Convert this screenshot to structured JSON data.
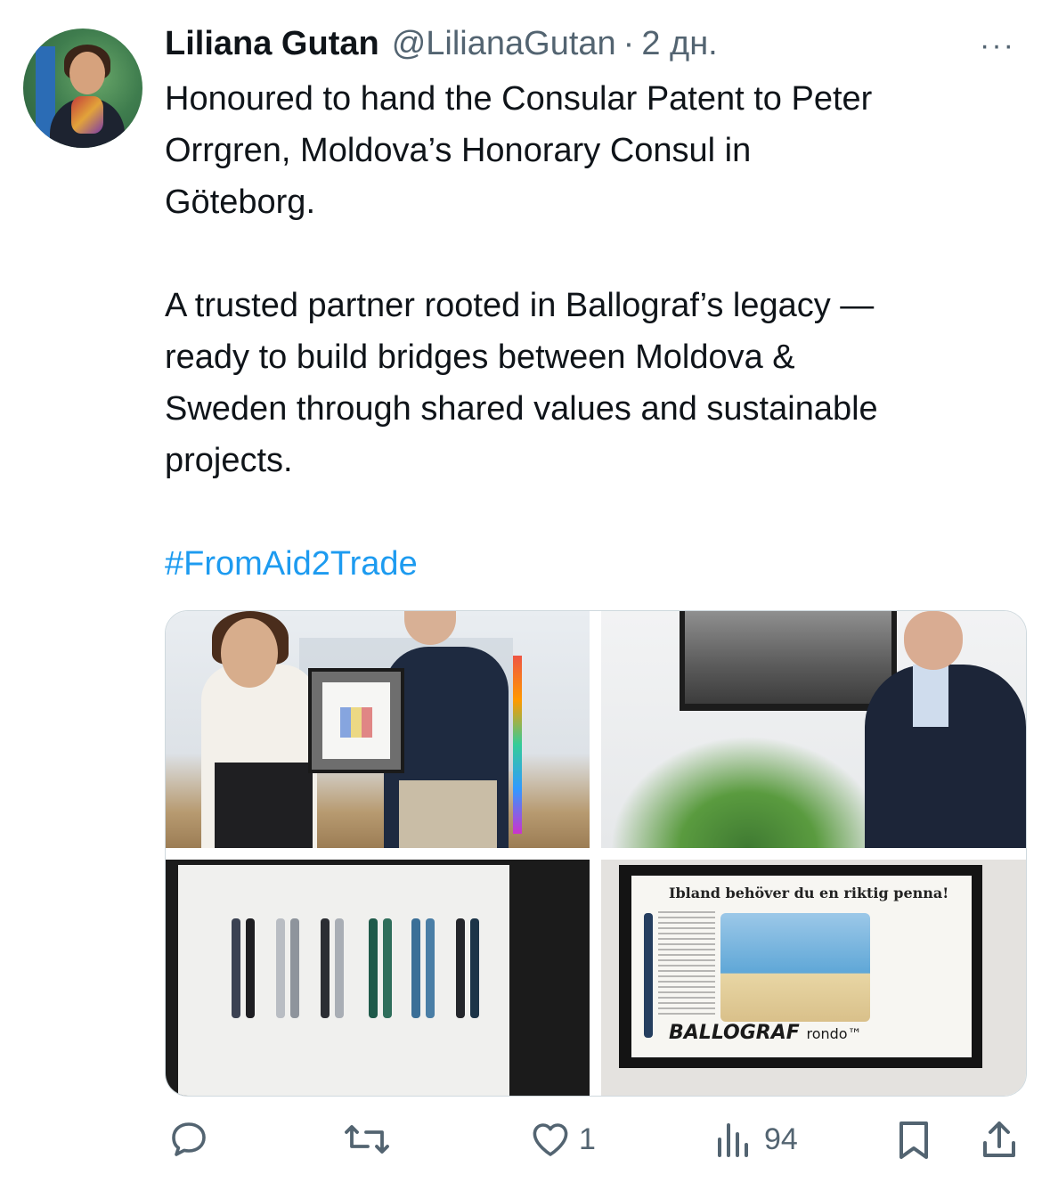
{
  "tweet": {
    "author_name": "Liliana Gutan",
    "handle": "@LilianaGutan",
    "separator": "·",
    "time": "2 дн.",
    "more_label": "···",
    "text_lines_p1": [
      "Honoured to hand the Consular Patent to Peter",
      "Orrgren, Moldova’s Honorary Consul in",
      "Göteborg."
    ],
    "text_lines_p2": [
      "A trusted partner rooted in Ballograf’s legacy —",
      "ready to build bridges between Moldova &",
      "Sweden through shared values and sustainable",
      "projects."
    ],
    "hashtag": "#FromAid2Trade"
  },
  "media": {
    "ad_headline": "Ibland behöver du en riktig penna!",
    "ad_brand": "BALLOGRAF",
    "ad_product": "rondo™"
  },
  "actions": {
    "reply_count": "",
    "retweet_count": "",
    "like_count": "1",
    "views_count": "94"
  },
  "icons": [
    "avatar",
    "more-icon",
    "reply-icon",
    "retweet-icon",
    "like-icon",
    "views-icon",
    "bookmark-icon",
    "share-icon"
  ],
  "colors": {
    "text": "#0f1419",
    "secondary": "#536471",
    "link": "#1d9bf0",
    "border": "#cfd9de"
  }
}
